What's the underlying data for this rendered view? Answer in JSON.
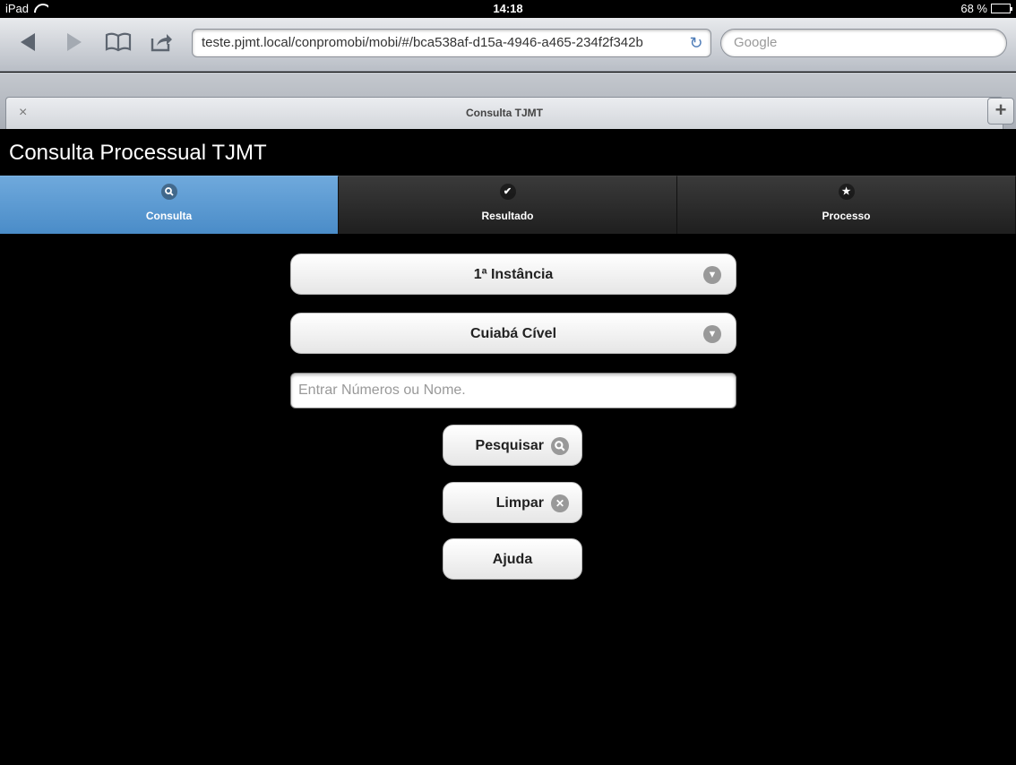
{
  "status_bar": {
    "device": "iPad",
    "time": "14:18",
    "battery": "68 %",
    "battery_level": 0.68
  },
  "browser": {
    "url": "teste.pjmt.local/conpromobi/mobi/#/bca538af-d15a-4946-a465-234f2f342b",
    "search_placeholder": "Google",
    "tab_title": "Consulta TJMT",
    "tab_close": "×",
    "new_tab": "+"
  },
  "app": {
    "title": "Consulta Processual TJMT",
    "accent": "#5b9bd5"
  },
  "navbar": {
    "tabs": [
      {
        "label": "Consulta",
        "icon": "search-icon",
        "active": true
      },
      {
        "label": "Resultado",
        "icon": "check-icon",
        "active": false
      },
      {
        "label": "Processo",
        "icon": "star-icon",
        "active": false
      }
    ]
  },
  "form": {
    "instance_select": "1ª Instância",
    "comarca_select": "Cuiabá Cível",
    "search_placeholder": "Entrar Números ou Nome.",
    "search_value": ""
  },
  "actions": {
    "search_label": "Pesquisar",
    "clear_label": "Limpar",
    "help_label": "Ajuda"
  }
}
